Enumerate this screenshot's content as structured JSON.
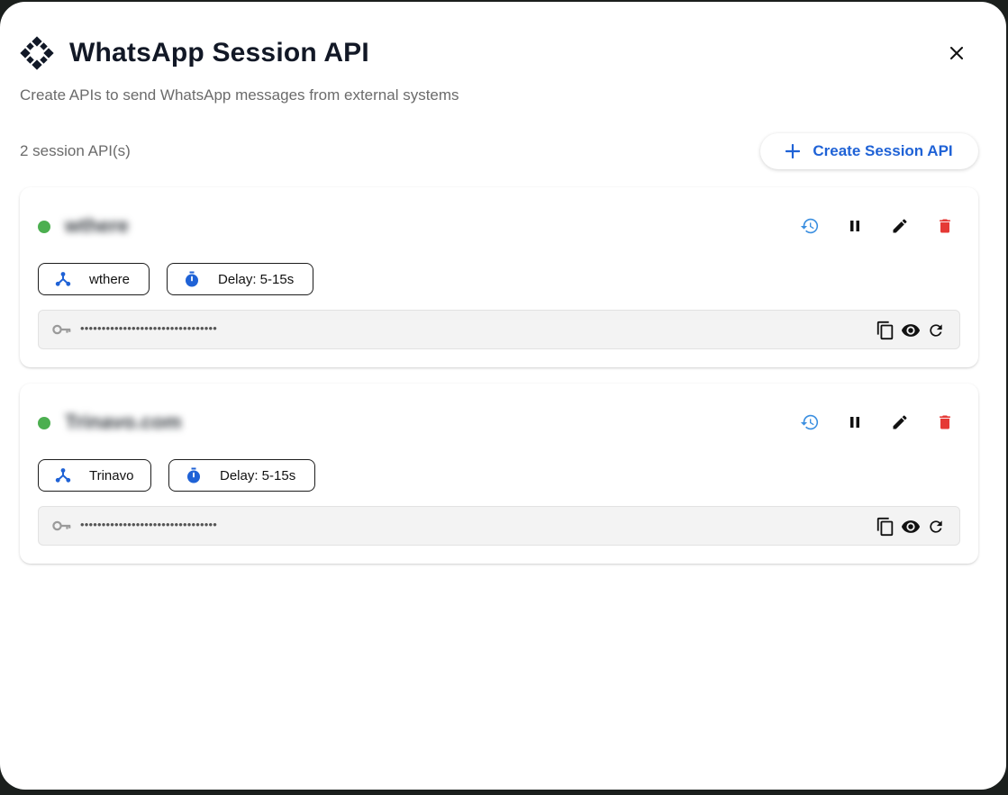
{
  "dialog": {
    "title": "WhatsApp Session API",
    "subtitle": "Create APIs to send WhatsApp messages from external systems",
    "count_text": "2 session API(s)",
    "create_label": "Create Session API",
    "icons": {
      "logo": "diamond-grid-logo-icon",
      "close": "close-icon",
      "create": "plus-icon"
    }
  },
  "colors": {
    "accent": "#1f62d6",
    "status_active": "#4caf50",
    "history": "#3b8fe0",
    "delete": "#e53935"
  },
  "sessions": [
    {
      "name": "wthere",
      "status": "active",
      "device": "wthere",
      "delay": "Delay: 5-15s",
      "key_masked": "••••••••••••••••••••••••••••••••"
    },
    {
      "name": "Trinavo.com",
      "status": "active",
      "device": "Trinavo",
      "delay": "Delay: 5-15s",
      "key_masked": "••••••••••••••••••••••••••••••••"
    }
  ],
  "card_icons": {
    "history": "history-icon",
    "pause": "pause-icon",
    "edit": "pencil-icon",
    "delete": "trash-icon",
    "device": "hub-icon",
    "timer": "stopwatch-icon",
    "key": "key-icon",
    "copy": "copy-icon",
    "reveal": "eye-icon",
    "regenerate": "refresh-icon"
  }
}
